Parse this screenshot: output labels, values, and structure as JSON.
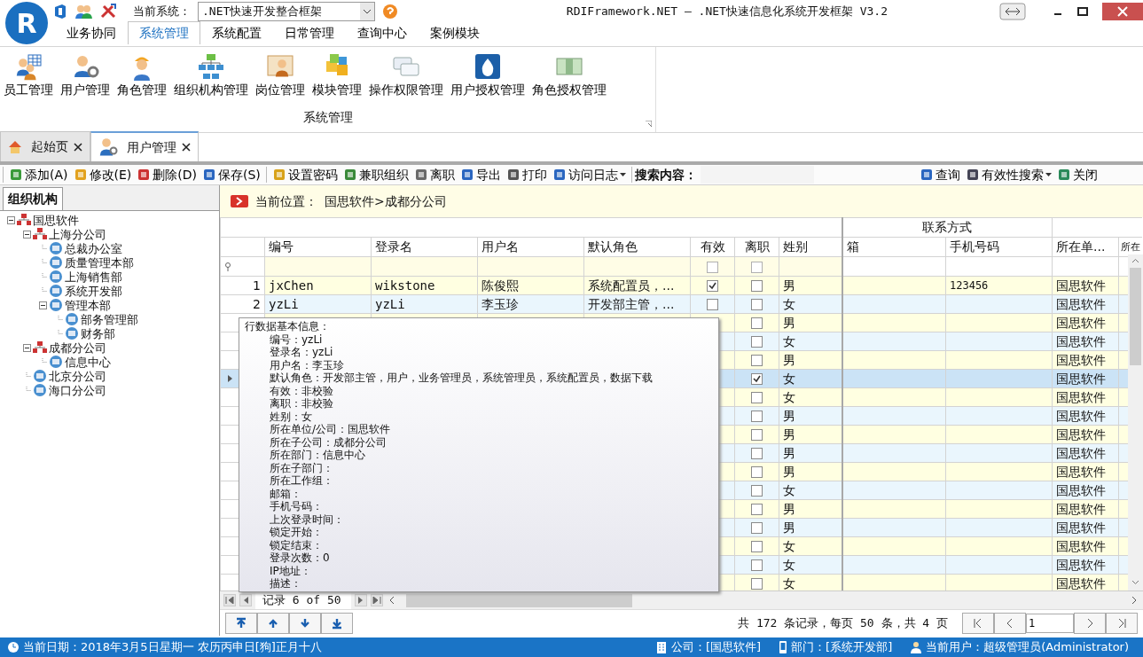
{
  "window": {
    "logo_letter": "R",
    "title": "RDIFramework.NET — .NET快速信息化系统开发框架 V3.2"
  },
  "quick_access": {
    "system_label": "当前系统：",
    "system_value": ".NET快速开发整合框架"
  },
  "ribbon": {
    "tabs": [
      {
        "label": "业务协同",
        "selected": false
      },
      {
        "label": "系统管理",
        "selected": true
      },
      {
        "label": "系统配置",
        "selected": false
      },
      {
        "label": "日常管理",
        "selected": false
      },
      {
        "label": "查询中心",
        "selected": false
      },
      {
        "label": "案例模块",
        "selected": false
      }
    ],
    "items": [
      "员工管理",
      "用户管理",
      "角色管理",
      "组织机构管理",
      "岗位管理",
      "模块管理",
      "操作权限管理",
      "用户授权管理",
      "角色授权管理"
    ],
    "group_label": "系统管理"
  },
  "doc_tabs": [
    {
      "label": "起始页",
      "selected": false
    },
    {
      "label": "用户管理",
      "selected": true
    }
  ],
  "toolbar": {
    "groups": [
      [
        {
          "label": "添加(A)",
          "dropdown": false
        },
        {
          "label": "修改(E)",
          "dropdown": false
        },
        {
          "label": "删除(D)",
          "dropdown": false
        },
        {
          "label": "保存(S)",
          "dropdown": false
        }
      ],
      [
        {
          "label": "设置密码",
          "dropdown": false
        },
        {
          "label": "兼职组织",
          "dropdown": false
        },
        {
          "label": "离职",
          "dropdown": false
        },
        {
          "label": "导出",
          "dropdown": false
        },
        {
          "label": "打印",
          "dropdown": false
        },
        {
          "label": "访问日志",
          "dropdown": true
        }
      ]
    ],
    "search_label": "搜索内容：",
    "right": [
      {
        "label": "查询",
        "dropdown": false
      },
      {
        "label": "有效性搜索",
        "dropdown": true
      },
      {
        "label": "关闭",
        "dropdown": false
      }
    ]
  },
  "org_panel": {
    "title": "组织机构",
    "tree": [
      {
        "label": "国思软件",
        "expanded": true,
        "children": [
          {
            "label": "上海分公司",
            "expanded": true,
            "children": [
              {
                "label": "总裁办公室"
              },
              {
                "label": "质量管理本部"
              },
              {
                "label": "上海销售部"
              },
              {
                "label": "系统开发部"
              },
              {
                "label": "管理本部",
                "expanded": true,
                "children": [
                  {
                    "label": "部务管理部"
                  },
                  {
                    "label": "财务部"
                  }
                ]
              }
            ]
          },
          {
            "label": "成都分公司",
            "expanded": true,
            "children": [
              {
                "label": "信息中心"
              }
            ]
          },
          {
            "label": "北京分公司"
          },
          {
            "label": "海口分公司"
          }
        ]
      }
    ]
  },
  "location": {
    "label": "当前位置：",
    "path": "国思软件>成都分公司"
  },
  "grid": {
    "band": "联系方式",
    "columns": [
      "编号",
      "登录名",
      "用户名",
      "默认角色",
      "有效",
      "离职",
      "姓别",
      "箱",
      "手机号码",
      "所在单...",
      "所在"
    ],
    "filter_checks": [
      false,
      false
    ],
    "rows": [
      {
        "number": "1",
        "code": "jxChen",
        "login": "wikstone",
        "name": "陈俊熙",
        "role": "系统配置员，...",
        "valid": true,
        "left": false,
        "sex": "男",
        "phone": "123456",
        "unit": "国思软件",
        "selected": false
      },
      {
        "number": "2",
        "code": "yzLi",
        "login": "yzLi",
        "name": "李玉珍",
        "role": "开发部主管，...",
        "valid": false,
        "left": false,
        "sex": "女",
        "unit": "国思软件",
        "selected": false
      },
      {
        "left": false,
        "sex": "男",
        "unit": "国思软件",
        "selected": false
      },
      {
        "left": false,
        "sex": "女",
        "unit": "国思软件",
        "selected": false
      },
      {
        "left": false,
        "sex": "男",
        "unit": "国思软件",
        "selected": false
      },
      {
        "left": true,
        "sex": "女",
        "unit": "国思软件",
        "selected": true
      },
      {
        "left": false,
        "sex": "女",
        "unit": "国思软件",
        "selected": false
      },
      {
        "left": false,
        "sex": "男",
        "unit": "国思软件",
        "selected": false
      },
      {
        "left": false,
        "sex": "男",
        "unit": "国思软件",
        "selected": false
      },
      {
        "left": false,
        "sex": "男",
        "unit": "国思软件",
        "selected": false
      },
      {
        "left": false,
        "sex": "男",
        "unit": "国思软件",
        "selected": false
      },
      {
        "left": false,
        "sex": "女",
        "unit": "国思软件",
        "selected": false
      },
      {
        "left": false,
        "sex": "男",
        "unit": "国思软件",
        "selected": false
      },
      {
        "left": false,
        "sex": "男",
        "unit": "国思软件",
        "selected": false
      },
      {
        "left": false,
        "sex": "女",
        "unit": "国思软件",
        "selected": false
      },
      {
        "left": false,
        "sex": "女",
        "unit": "国思软件",
        "selected": false
      },
      {
        "left": false,
        "sex": "女",
        "unit": "国思软件",
        "selected": false
      }
    ],
    "tooltip": {
      "title": "行数据基本信息：",
      "lines": [
        "编号：yzLi",
        "登录名：yzLi",
        "用户名：李玉珍",
        "默认角色：开发部主管，用户，业务管理员，系统管理员，系统配置员，数据下载",
        "有效：非校验",
        "离职：非校验",
        "姓别：女",
        "所在单位/公司：国思软件",
        "所在子公司：成都分公司",
        "所在部门：信息中心",
        "所在子部门：",
        "所在工作组：",
        "邮箱：",
        "手机号码：",
        "上次登录时间：",
        "锁定开始：",
        "锁定结束：",
        "登录次数：0",
        "IP地址：",
        "描述："
      ]
    },
    "navigator": "记录 6 of 50"
  },
  "pager": {
    "summary": "共 172 条记录，每页 50 条，共 4 页",
    "page": "1"
  },
  "status_bar": {
    "date": "当前日期：2018年3月5日星期一 农历丙申日[狗]正月十八",
    "company": "公司：[国思软件]",
    "department": "部门：[系统开发部]",
    "user": "当前用户：超级管理员(Administrator)"
  }
}
